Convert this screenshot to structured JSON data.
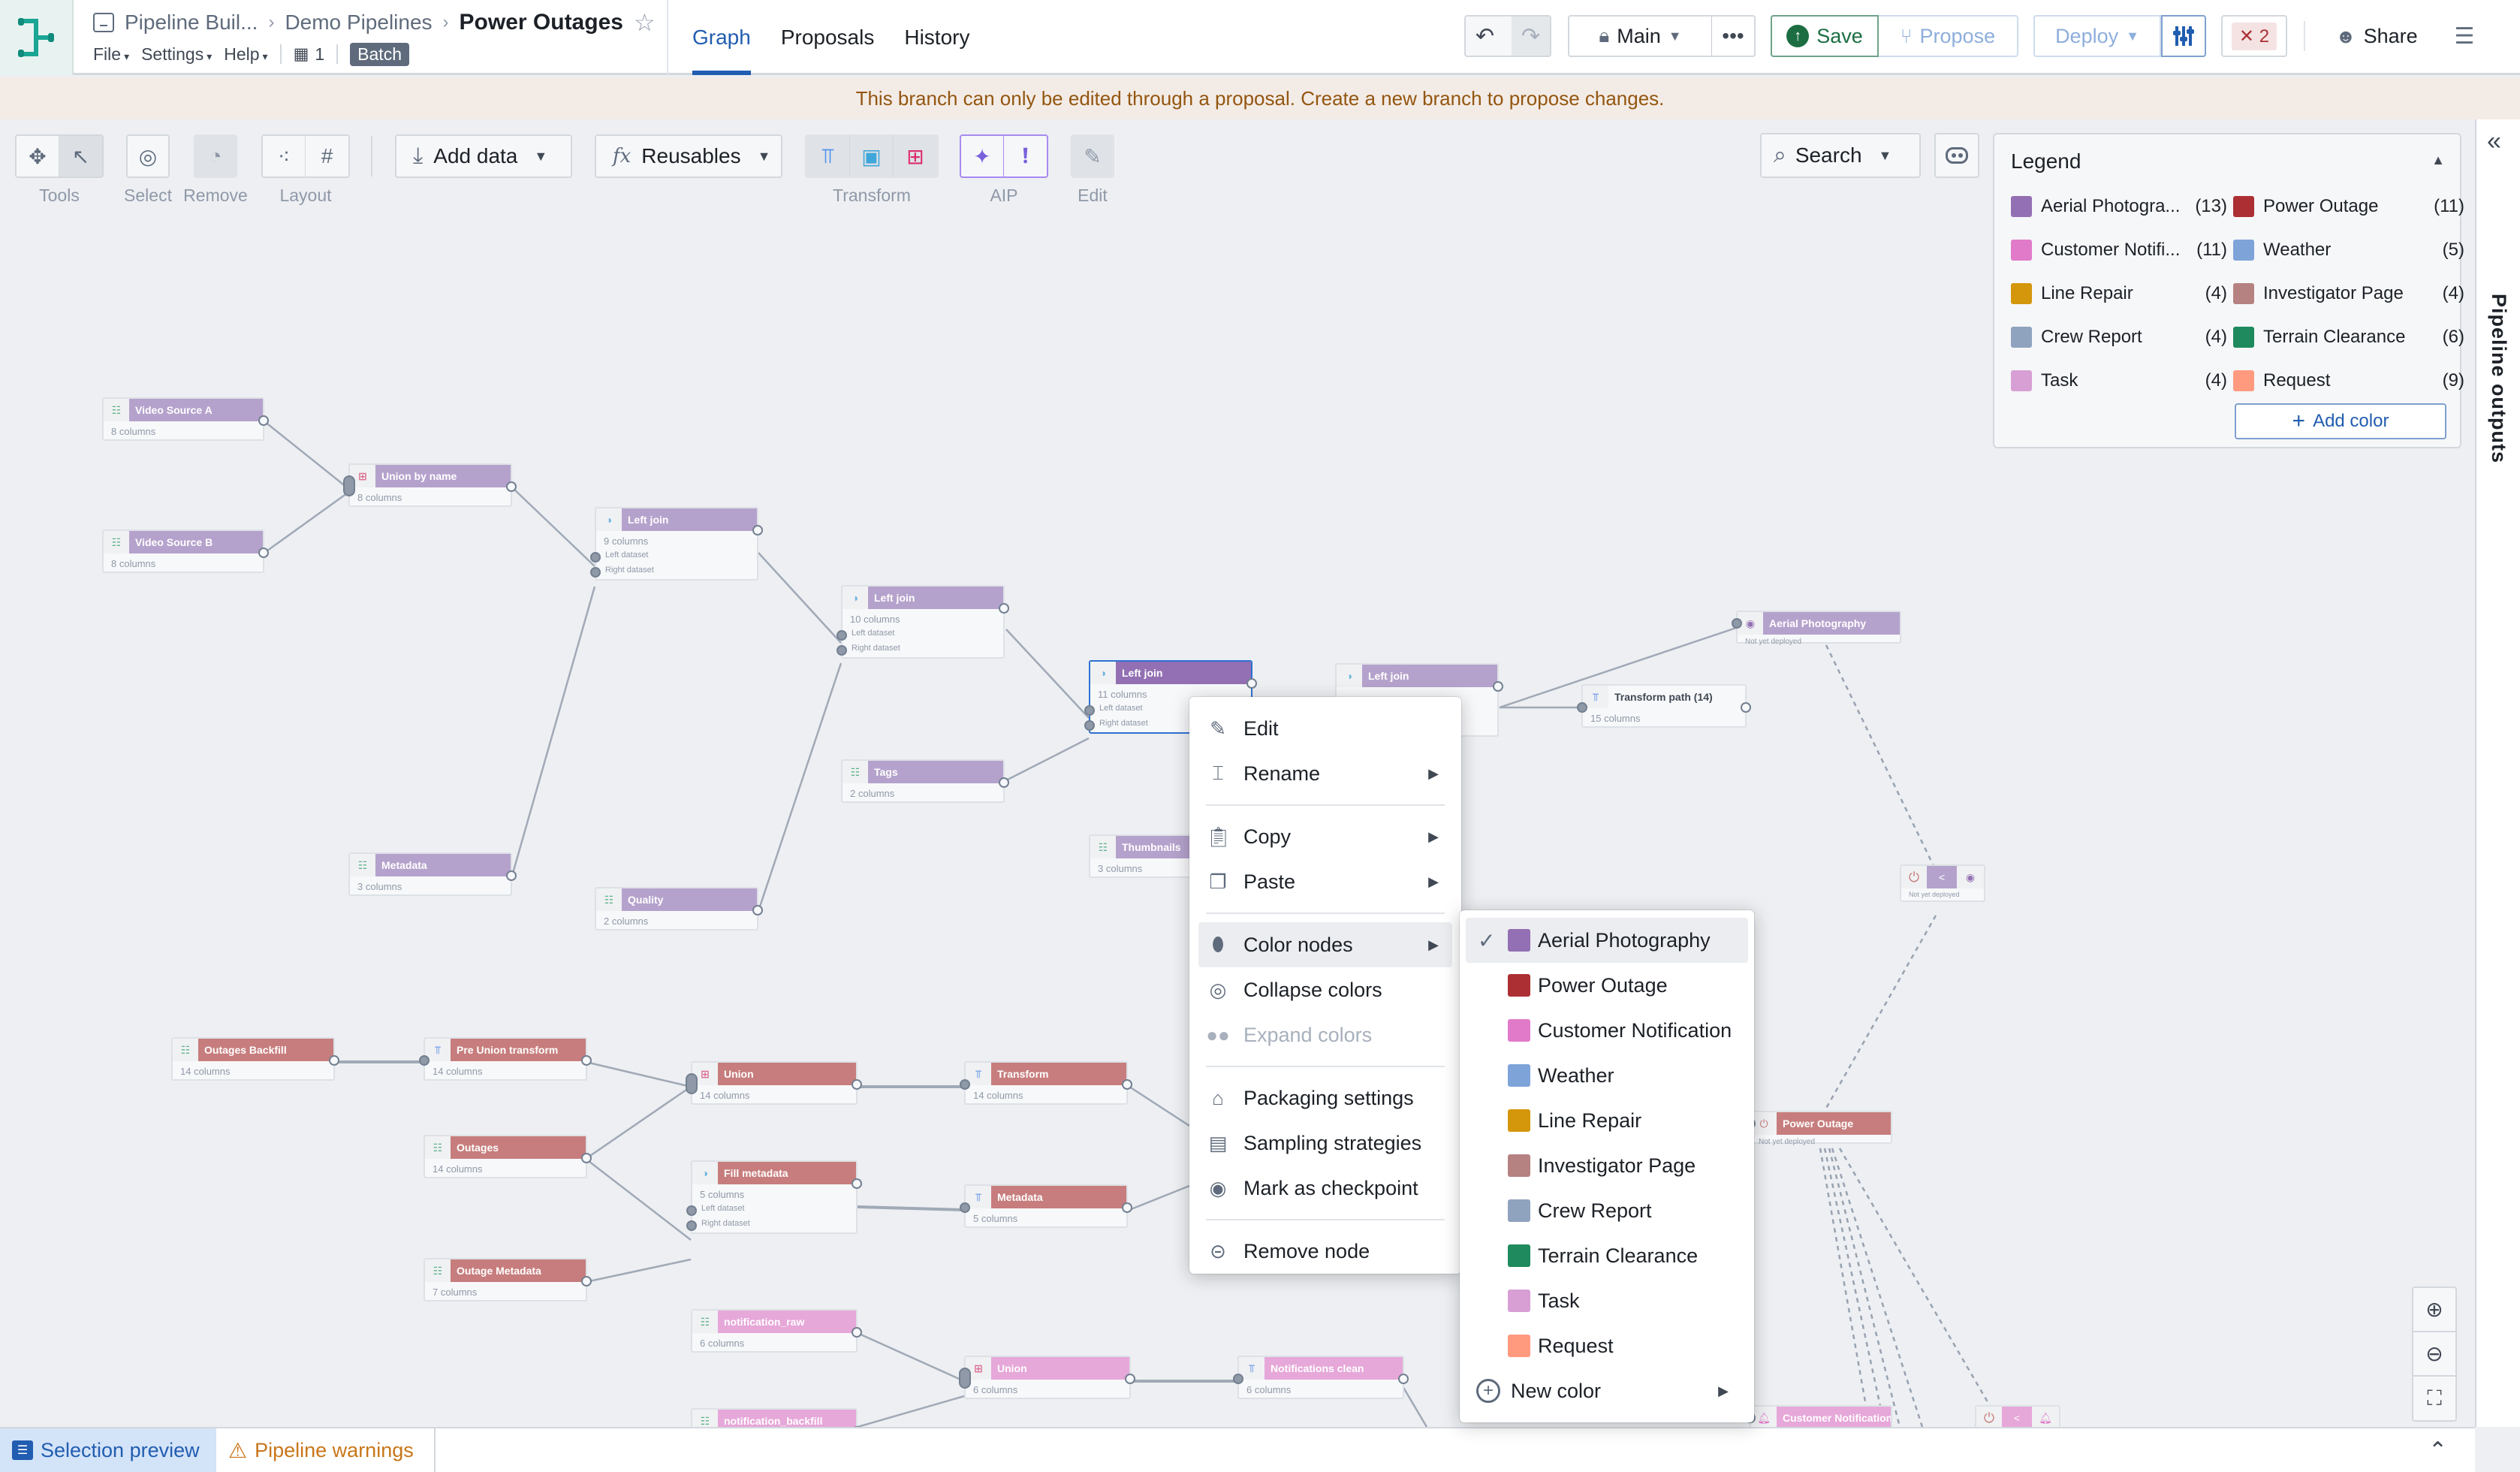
{
  "header": {
    "breadcrumb": [
      "Pipeline Buil...",
      "Demo Pipelines"
    ],
    "title": "Power Outages",
    "menus": [
      "File",
      "Settings",
      "Help"
    ],
    "workspace_count": "1",
    "mode_badge": "Batch",
    "tabs": [
      {
        "label": "Graph",
        "active": true
      },
      {
        "label": "Proposals",
        "active": false
      },
      {
        "label": "History",
        "active": false
      }
    ],
    "branch": "Main",
    "save_label": "Save",
    "propose_label": "Propose",
    "deploy_label": "Deploy",
    "error_count": "2",
    "share_label": "Share"
  },
  "banner": {
    "text": "This branch can only be edited through a proposal. Create a new branch to propose changes."
  },
  "toolbar": {
    "groups": [
      {
        "label": "Tools"
      },
      {
        "label": "Select"
      },
      {
        "label": "Remove"
      },
      {
        "label": "Layout"
      },
      {
        "label": "Transform"
      },
      {
        "label": "AIP"
      },
      {
        "label": "Edit"
      }
    ],
    "add_data_label": "Add data",
    "reusables_label": "Reusables",
    "search_label": "Search"
  },
  "legend": {
    "title": "Legend",
    "items": [
      {
        "name": "Aerial Photogra...",
        "count": "(13)",
        "color": "#9370b3"
      },
      {
        "name": "Power Outage",
        "count": "(11)",
        "color": "#ac2f33"
      },
      {
        "name": "Customer Notifi...",
        "count": "(11)",
        "color": "#e17ac9"
      },
      {
        "name": "Weather",
        "count": "(5)",
        "color": "#7ea3d9"
      },
      {
        "name": "Line Repair",
        "count": "(4)",
        "color": "#d4960a"
      },
      {
        "name": "Investigator Page",
        "count": "(4)",
        "color": "#b58281"
      },
      {
        "name": "Crew Report",
        "count": "(4)",
        "color": "#8fa3bf"
      },
      {
        "name": "Terrain Clearance",
        "count": "(6)",
        "color": "#1e8a5d"
      },
      {
        "name": "Task",
        "count": "(4)",
        "color": "#d89fd4"
      },
      {
        "name": "Request",
        "count": "(9)",
        "color": "#ff9a7f"
      }
    ],
    "add_color_label": "Add color"
  },
  "right_rail": {
    "label": "Pipeline outputs"
  },
  "nodes": [
    {
      "id": "video-source-a",
      "title": "Video Source A",
      "sub": "8 columns",
      "kind": "dataset",
      "palette": "purple"
    },
    {
      "id": "video-source-b",
      "title": "Video Source B",
      "sub": "8 columns",
      "kind": "dataset",
      "palette": "purple"
    },
    {
      "id": "union-by-name",
      "title": "Union by name",
      "sub": "8 columns",
      "kind": "union",
      "palette": "purple"
    },
    {
      "id": "left-join-1",
      "title": "Left join",
      "sub": "9 columns",
      "kind": "join",
      "palette": "purple",
      "left_label": "Left dataset",
      "right_label": "Right dataset"
    },
    {
      "id": "left-join-2",
      "title": "Left join",
      "sub": "10 columns",
      "kind": "join",
      "palette": "purple",
      "left_label": "Left dataset",
      "right_label": "Right dataset"
    },
    {
      "id": "left-join-3",
      "title": "Left join",
      "sub": "11 columns",
      "kind": "join",
      "palette": "purple-sel",
      "selected": true,
      "left_label": "Left dataset",
      "right_label": "Right dataset"
    },
    {
      "id": "left-join-4",
      "title": "Left join",
      "sub": "",
      "kind": "join",
      "palette": "purple"
    },
    {
      "id": "tags",
      "title": "Tags",
      "sub": "2 columns",
      "kind": "dataset",
      "palette": "purple"
    },
    {
      "id": "metadata-a",
      "title": "Metadata",
      "sub": "3 columns",
      "kind": "dataset",
      "palette": "purple"
    },
    {
      "id": "quality",
      "title": "Quality",
      "sub": "2 columns",
      "kind": "dataset",
      "palette": "purple"
    },
    {
      "id": "thumbnails",
      "title": "Thumbnails",
      "sub": "3 columns",
      "kind": "dataset",
      "palette": "purple"
    },
    {
      "id": "transform-path",
      "title": "Transform path (14)",
      "sub": "15 columns",
      "kind": "transform",
      "palette": "plain"
    },
    {
      "id": "aerial-photography",
      "title": "Aerial Photography",
      "sub": "Not yet deployed",
      "kind": "output",
      "palette": "purple"
    },
    {
      "id": "outages-backfill",
      "title": "Outages Backfill",
      "sub": "14 columns",
      "kind": "dataset",
      "palette": "red"
    },
    {
      "id": "pre-union-transform",
      "title": "Pre Union transform",
      "sub": "14 columns",
      "kind": "transform",
      "palette": "red"
    },
    {
      "id": "union-outages",
      "title": "Union",
      "sub": "14 columns",
      "kind": "union",
      "palette": "red"
    },
    {
      "id": "transform-outages",
      "title": "Transform",
      "sub": "14 columns",
      "kind": "transform",
      "palette": "red"
    },
    {
      "id": "outages",
      "title": "Outages",
      "sub": "14 columns",
      "kind": "dataset",
      "palette": "red"
    },
    {
      "id": "fill-metadata",
      "title": "Fill metadata",
      "sub": "5 columns",
      "kind": "join",
      "palette": "red",
      "left_label": "Left dataset",
      "right_label": "Right dataset"
    },
    {
      "id": "metadata-b",
      "title": "Metadata",
      "sub": "5 columns",
      "kind": "transform",
      "palette": "red"
    },
    {
      "id": "outage-metadata",
      "title": "Outage Metadata",
      "sub": "7 columns",
      "kind": "dataset",
      "palette": "red"
    },
    {
      "id": "power-outage",
      "title": "Power Outage",
      "sub": "Not yet deployed",
      "kind": "output",
      "palette": "red"
    },
    {
      "id": "notification-raw",
      "title": "notification_raw",
      "sub": "6 columns",
      "kind": "dataset",
      "palette": "pink"
    },
    {
      "id": "notification-backfill",
      "title": "notification_backfill",
      "sub": "",
      "kind": "dataset",
      "palette": "pink"
    },
    {
      "id": "union-notifications",
      "title": "Union",
      "sub": "6 columns",
      "kind": "union",
      "palette": "pink"
    },
    {
      "id": "notifications-clean",
      "title": "Notifications clean",
      "sub": "6 columns",
      "kind": "transform",
      "palette": "pink"
    },
    {
      "id": "customer-notification",
      "title": "Customer Notification",
      "sub": "",
      "kind": "output",
      "palette": "pink"
    }
  ],
  "ontology_nodes": [
    {
      "id": "aerial-ontology",
      "sub": "Not yet deployed"
    },
    {
      "id": "notification-ontology",
      "sub": ""
    }
  ],
  "context_menu": {
    "items": [
      {
        "label": "Edit",
        "icon": "pencil-icon",
        "submenu": false
      },
      {
        "label": "Rename",
        "icon": "rename-icon",
        "submenu": true
      },
      {
        "label": "Copy",
        "icon": "clipboard-icon",
        "submenu": true
      },
      {
        "label": "Paste",
        "icon": "paste-icon",
        "submenu": true
      },
      {
        "label": "Color nodes",
        "icon": "paint-bucket-icon",
        "submenu": true,
        "active": true
      },
      {
        "label": "Collapse colors",
        "icon": "collapse-colors-icon",
        "submenu": false
      },
      {
        "label": "Expand colors",
        "icon": "expand-colors-icon",
        "submenu": false,
        "disabled": true
      },
      {
        "label": "Packaging settings",
        "icon": "shop-icon",
        "submenu": false
      },
      {
        "label": "Sampling strategies",
        "icon": "sampling-icon",
        "submenu": false
      },
      {
        "label": "Mark as checkpoint",
        "icon": "map-marker-icon",
        "submenu": false
      },
      {
        "label": "Remove node",
        "icon": "remove-circle-icon",
        "submenu": false
      }
    ]
  },
  "color_submenu": {
    "items": [
      {
        "label": "Aerial Photography",
        "color": "#9370b3",
        "checked": true
      },
      {
        "label": "Power Outage",
        "color": "#ac2f33",
        "checked": false
      },
      {
        "label": "Customer Notification",
        "color": "#e17ac9",
        "checked": false
      },
      {
        "label": "Weather",
        "color": "#7ea3d9",
        "checked": false
      },
      {
        "label": "Line Repair",
        "color": "#d4960a",
        "checked": false
      },
      {
        "label": "Investigator Page",
        "color": "#b58281",
        "checked": false
      },
      {
        "label": "Crew Report",
        "color": "#8fa3bf",
        "checked": false
      },
      {
        "label": "Terrain Clearance",
        "color": "#1e8a5d",
        "checked": false
      },
      {
        "label": "Task",
        "color": "#d89fd4",
        "checked": false
      },
      {
        "label": "Request",
        "color": "#ff9a7f",
        "checked": false
      }
    ],
    "new_color_label": "New color"
  },
  "bottom_bar": {
    "selection_preview_label": "Selection preview",
    "pipeline_warnings_label": "Pipeline warnings"
  }
}
